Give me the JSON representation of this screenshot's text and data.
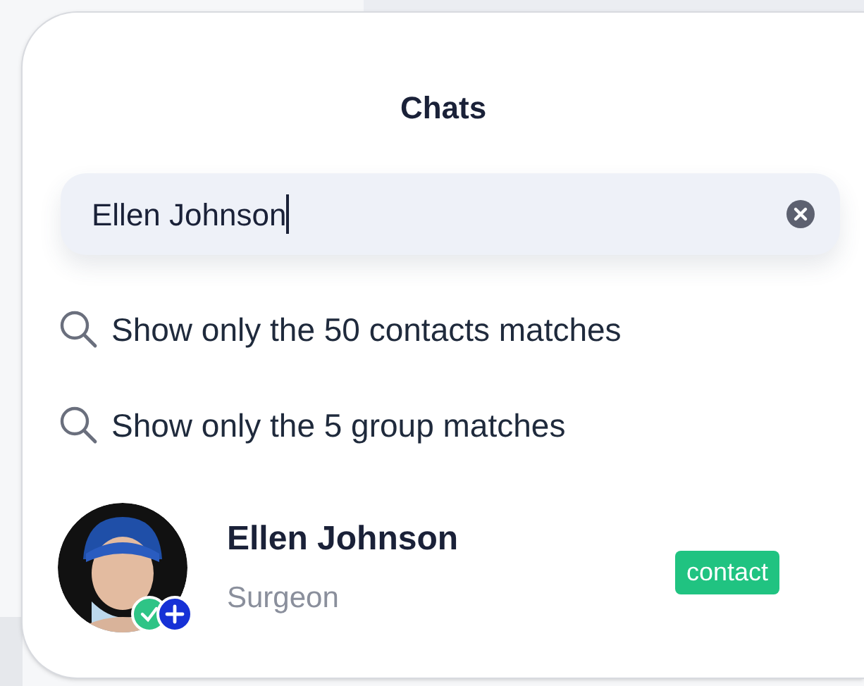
{
  "panel": {
    "title": "Chats"
  },
  "search": {
    "value": "Ellen Johnson",
    "focused": true
  },
  "suggestions": [
    {
      "label": "Show only the 50 contacts matches"
    },
    {
      "label": "Show only the 5 group matches"
    }
  ],
  "results": [
    {
      "name": "Ellen Johnson",
      "role": "Surgeon",
      "tag": "contact",
      "verified": true,
      "kind": "contact"
    }
  ]
}
